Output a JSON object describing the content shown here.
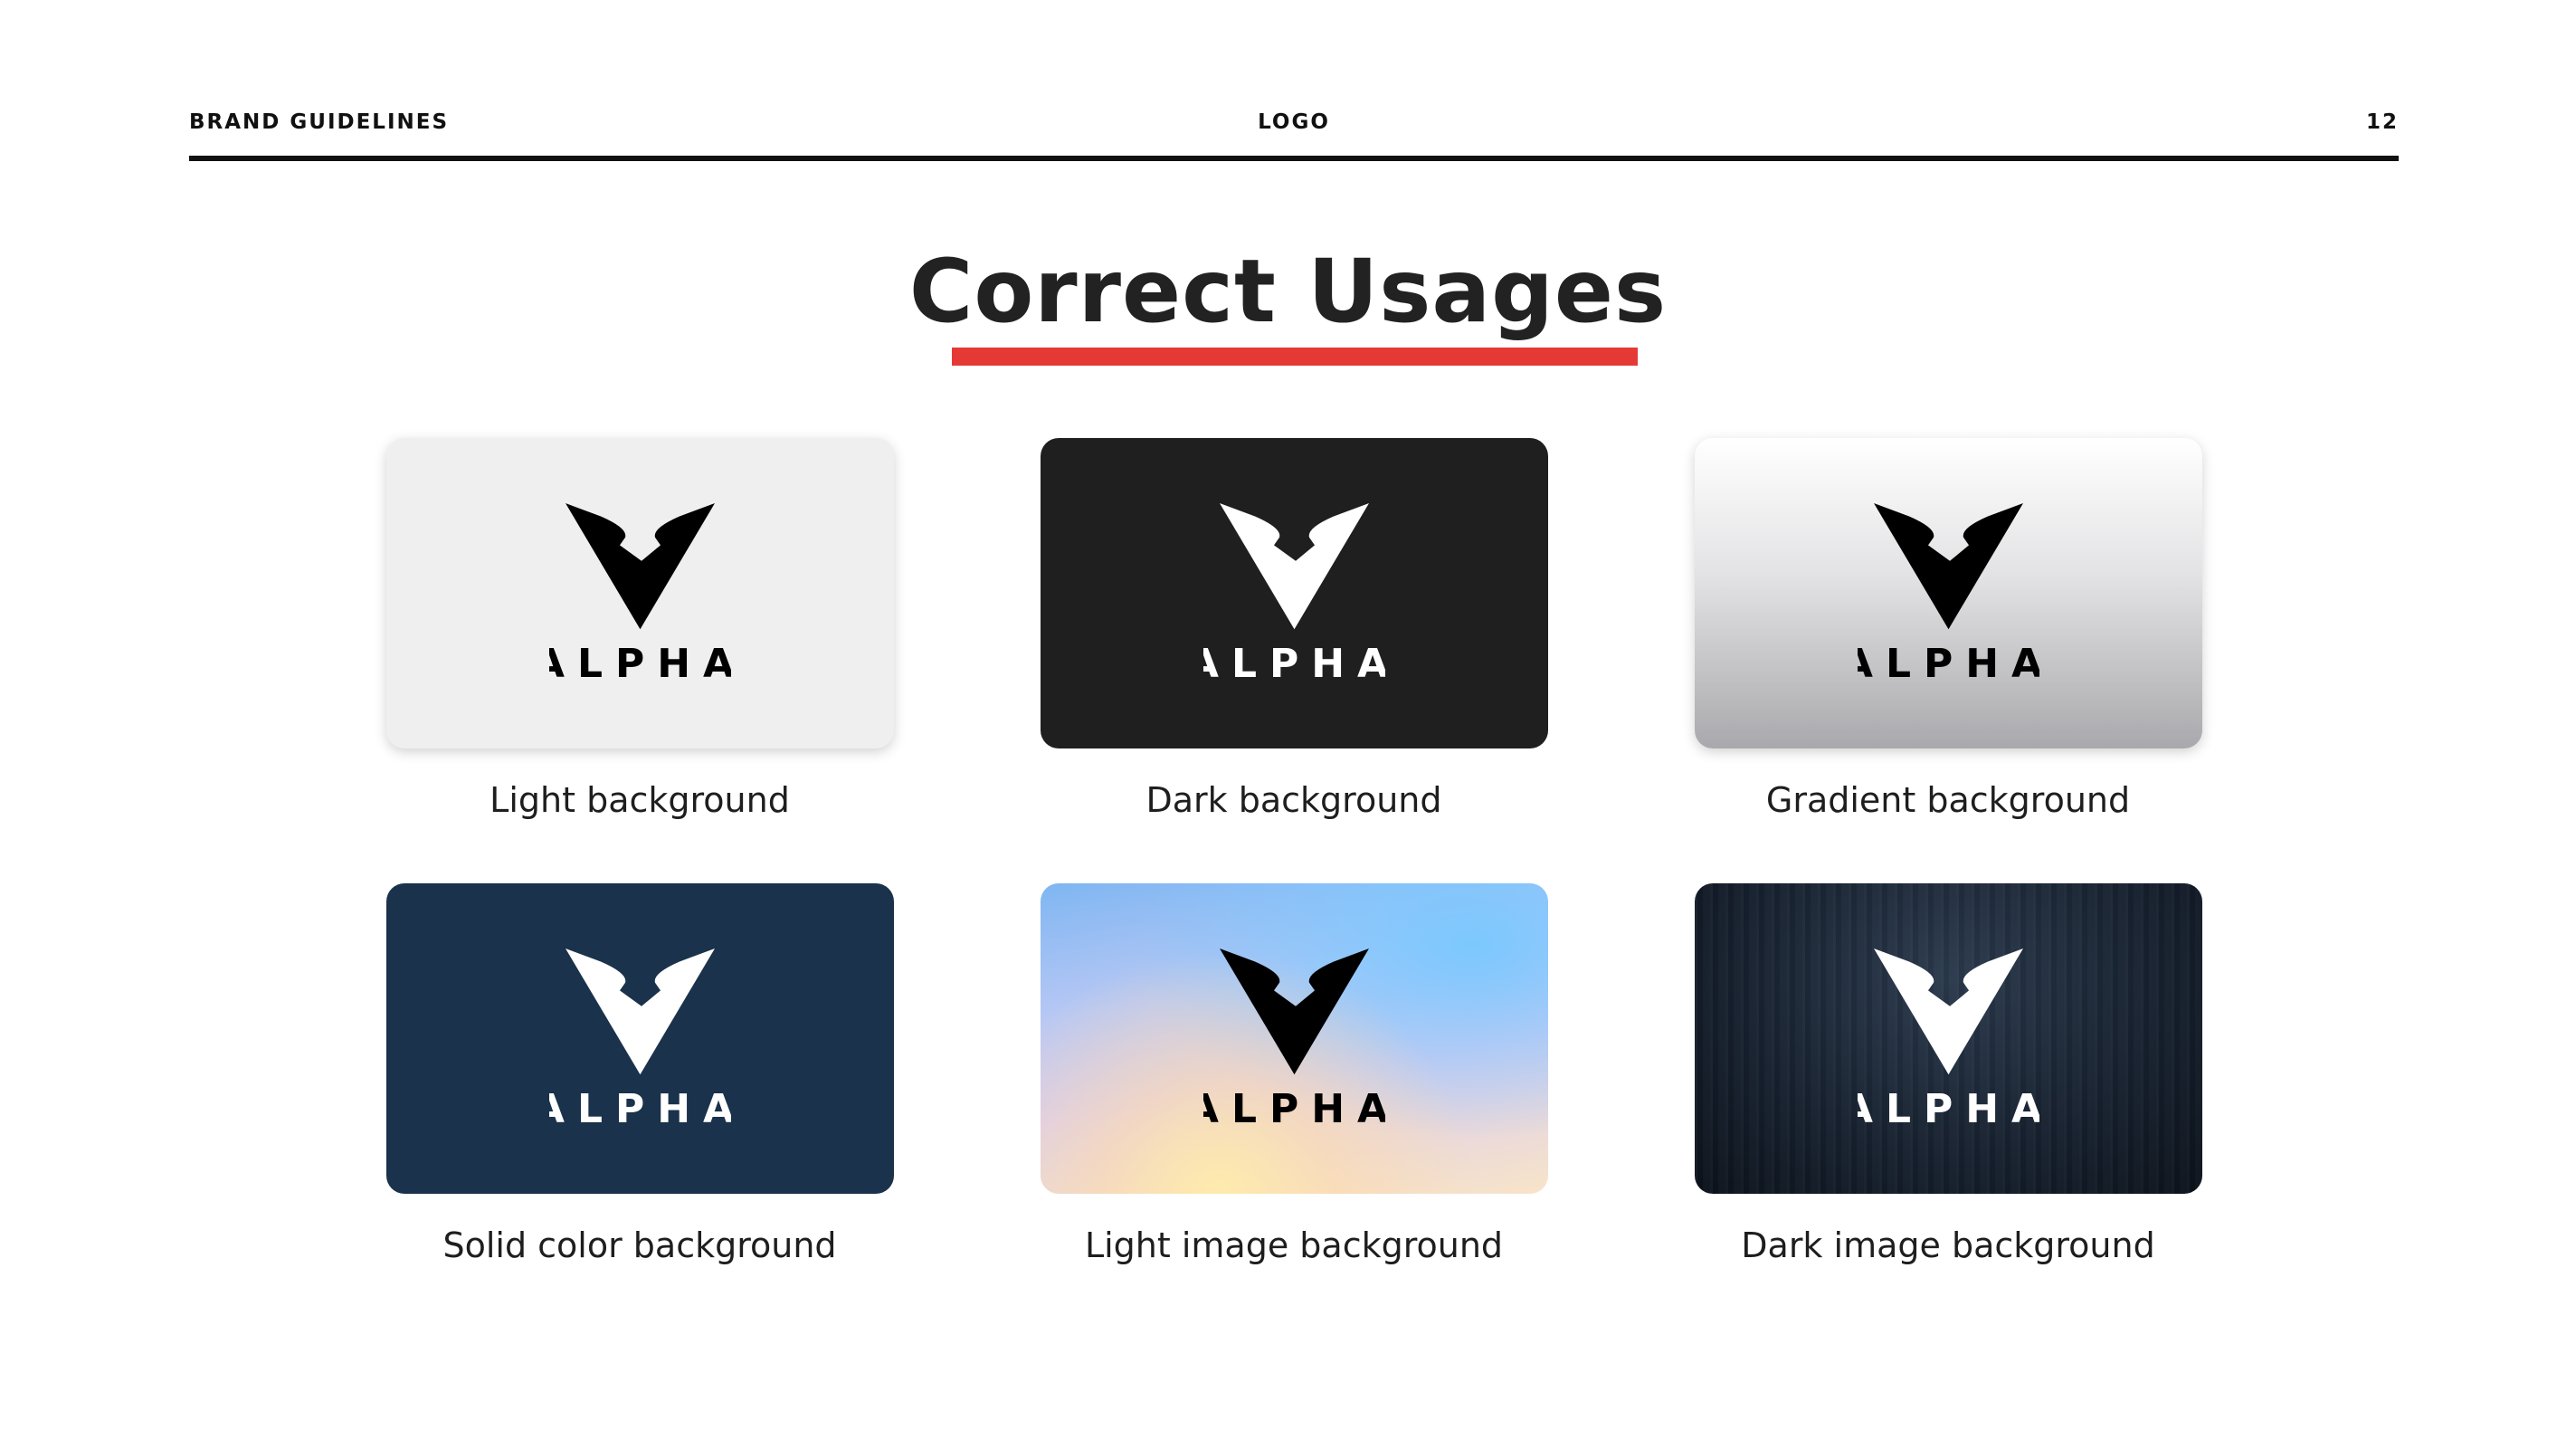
{
  "header": {
    "left": "BRAND GUIDELINES",
    "center": "LOGO",
    "page_number": "12"
  },
  "title": "Correct Usages",
  "accent_color": "#e53935",
  "logo": {
    "wordmark": "ALPHA",
    "icon": "alpha-v-logo-icon"
  },
  "cards": [
    {
      "caption": "Light background",
      "background": "#efefef",
      "logo_color": "#000000"
    },
    {
      "caption": "Dark background",
      "background": "#1f1f1f",
      "logo_color": "#ffffff"
    },
    {
      "caption": "Gradient background",
      "background": "gradient #ffffff to #a9a9ad",
      "logo_color": "#000000"
    },
    {
      "caption": "Solid color background",
      "background": "#1a324b",
      "logo_color": "#ffffff"
    },
    {
      "caption": "Light image background",
      "background": "sky image",
      "logo_color": "#000000"
    },
    {
      "caption": "Dark image background",
      "background": "dark wood image",
      "logo_color": "#ffffff"
    }
  ]
}
